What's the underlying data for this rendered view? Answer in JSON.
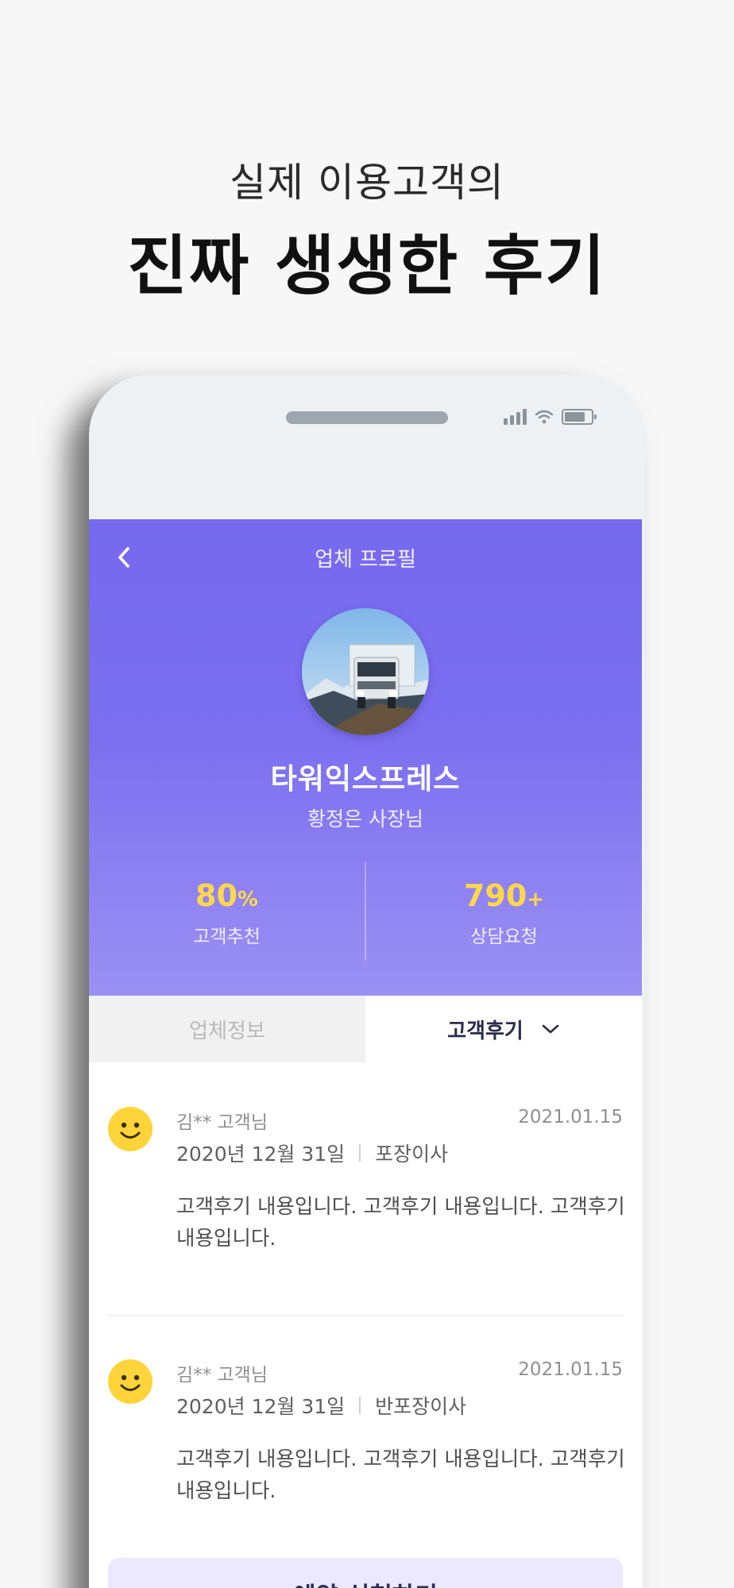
{
  "headline": {
    "sub": "실제 이용고객의",
    "main": "진짜 생생한 후기"
  },
  "header": {
    "title": "업체 프로필"
  },
  "profile": {
    "company_name": "타워익스프레스",
    "owner": "황정은 사장님",
    "image": "truck-photo"
  },
  "stats": [
    {
      "value": "80",
      "unit": "%",
      "label": "고객추천"
    },
    {
      "value": "790",
      "unit": "+",
      "label": "상담요청"
    }
  ],
  "tabs": {
    "info": "업체정보",
    "reviews": "고객후기"
  },
  "reviews": [
    {
      "reviewer": "김** 고객님",
      "date": "2021.01.15",
      "move_date": "2020년 12월 31일",
      "service": "포장이사",
      "body": "고객후기 내용입니다. 고객후기 내용입니다. 고객후기 내용입니다."
    },
    {
      "reviewer": "김** 고객님",
      "date": "2021.01.15",
      "move_date": "2020년 12월 31일",
      "service": "반포장이사",
      "body": "고객후기 내용입니다. 고객후기 내용입니다. 고객후기 내용입니다."
    }
  ],
  "cta": {
    "label": "예약 신청하기"
  },
  "colors": {
    "brand": "#7669ee",
    "accent": "#ffd84a",
    "cta_bg": "#ece8fd"
  },
  "icons": {
    "back": "chevron-left-icon",
    "tab_dropdown": "chevron-down-icon",
    "reviewer": "smiley-icon"
  }
}
